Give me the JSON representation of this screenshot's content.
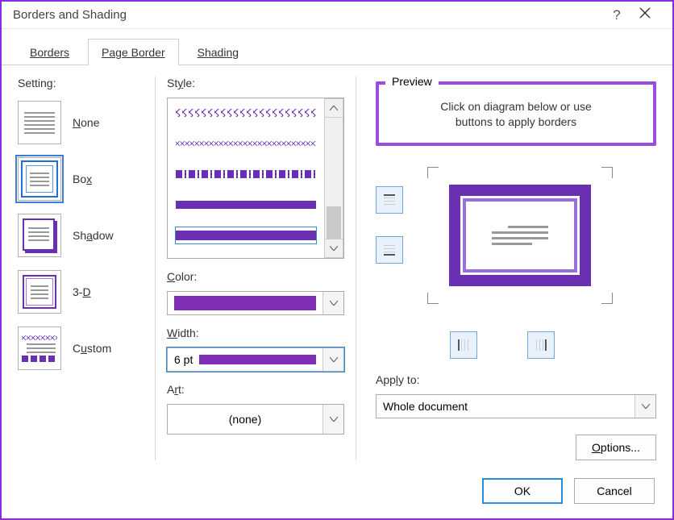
{
  "window": {
    "title": "Borders and Shading"
  },
  "tabs": {
    "borders": "Borders",
    "page_border": "Page Border",
    "shading": "Shading"
  },
  "setting": {
    "label": "Setting:",
    "items": {
      "none": "None",
      "box": "Box",
      "shadow": "Shadow",
      "threeD": "3-D",
      "custom": "Custom"
    }
  },
  "style": {
    "label_style": "Style:",
    "label_color": "Color:",
    "label_width": "Width:",
    "label_art": "Art:",
    "width_value": "6 pt",
    "art_value": "(none)",
    "color_value": "#7e2fb5"
  },
  "preview": {
    "legend": "Preview",
    "hint_line1": "Click on diagram below or use",
    "hint_line2": "buttons to apply borders",
    "apply_to_label": "Apply to:",
    "apply_to_value": "Whole document",
    "options_btn": "Options..."
  },
  "footer": {
    "ok": "OK",
    "cancel": "Cancel"
  }
}
